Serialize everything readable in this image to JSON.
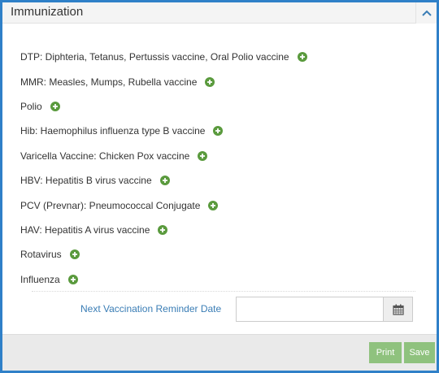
{
  "panel": {
    "title": "Immunization"
  },
  "vaccines": [
    {
      "label": "DTP: Diphteria, Tetanus, Pertussis vaccine, Oral Polio vaccine"
    },
    {
      "label": "MMR: Measles, Mumps, Rubella vaccine"
    },
    {
      "label": "Polio"
    },
    {
      "label": "Hib: Haemophilus influenza type B vaccine"
    },
    {
      "label": "Varicella Vaccine: Chicken Pox vaccine"
    },
    {
      "label": "HBV: Hepatitis B virus vaccine"
    },
    {
      "label": "PCV (Prevnar): Pneumococcal Conjugate"
    },
    {
      "label": "HAV: Hepatitis A virus vaccine"
    },
    {
      "label": "Rotavirus"
    },
    {
      "label": "Influenza"
    }
  ],
  "reminder": {
    "label": "Next Vaccination Reminder Date",
    "value": ""
  },
  "footer": {
    "print_label": "Print",
    "save_label": "Save"
  },
  "colors": {
    "border": "#2f80c8",
    "add_icon": "#5a9a3d",
    "button": "#8fc27e",
    "link_label": "#3a7db5"
  }
}
